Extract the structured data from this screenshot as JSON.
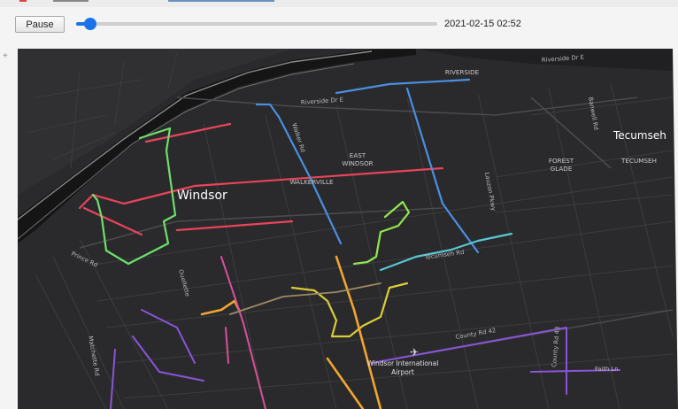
{
  "controls": {
    "pause_label": "Pause",
    "timestamp": "2021-02-15 02:52",
    "progress": 0.04
  },
  "map": {
    "labels": {
      "windsor": "Windsor",
      "tecumseh": "Tecumseh",
      "riverside": "RIVERSIDE",
      "east_windsor": "EAST\nWINDSOR",
      "walkerville": "WALKERVILLE",
      "forest_glade": "FOREST\nGLADE",
      "tecumseh_small": "TECUMSEH",
      "airport": "Windsor International\nAirport"
    },
    "roads": {
      "riverside_dr_e_top": "Riverside Dr E",
      "riverside_dr_e": "Riverside Dr E",
      "banwell_rd": "Banwell Rd",
      "lauzon_pkwy": "Lauzon Pkwy",
      "prince_rd": "Prince Rd",
      "matchette_rd": "Matchette Rd",
      "county_rd_42": "County Rd 42",
      "county_rd_43": "County Rd 43",
      "ouellette": "Ouellette",
      "tecumseh_rd": "Tecumseh Rd",
      "walker_rd": "Walker Rd",
      "faith_lane": "Faith Ln"
    },
    "colors": {
      "background": "#232325",
      "river": "#1a1a1c",
      "road": "#3b3b3f",
      "road_label": "#b9b9b9",
      "place_label": "#ffffff"
    }
  }
}
